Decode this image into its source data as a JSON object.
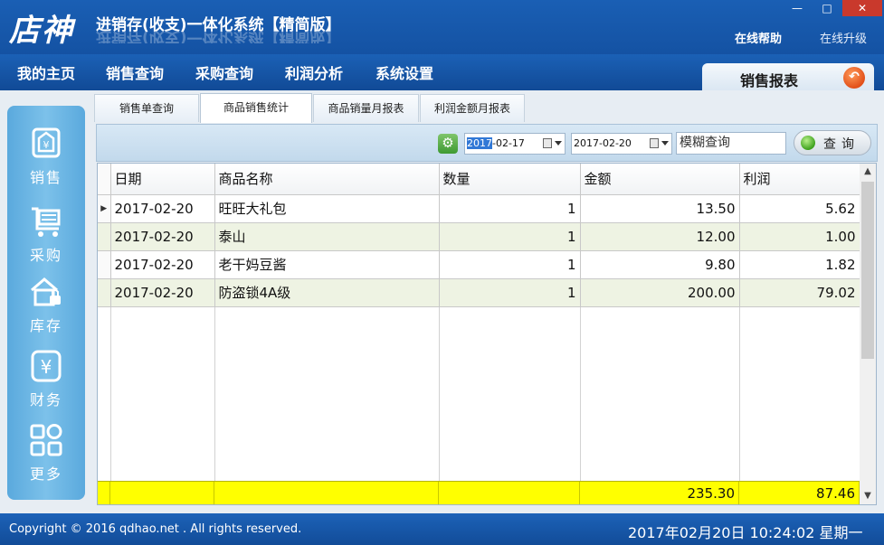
{
  "window": {
    "logo_text": "店神",
    "title": "进销存(收支)一体化系统【精简版】",
    "controls": {
      "minimize": "—",
      "maximize": "□",
      "close": "✕"
    },
    "links": {
      "help": "在线帮助",
      "upgrade": "在线升级"
    }
  },
  "menu": {
    "items": [
      {
        "label": "我的主页"
      },
      {
        "label": "销售查询"
      },
      {
        "label": "采购查询"
      },
      {
        "label": "利润分析"
      },
      {
        "label": "系统设置"
      }
    ],
    "report_tab": "销售报表"
  },
  "sidebar": {
    "items": [
      {
        "label": "销售",
        "icon": "sales-icon"
      },
      {
        "label": "采购",
        "icon": "cart-icon"
      },
      {
        "label": "库存",
        "icon": "warehouse-icon"
      },
      {
        "label": "财务",
        "icon": "yen-icon"
      },
      {
        "label": "更多",
        "icon": "grid-icon"
      }
    ]
  },
  "tabs": [
    {
      "label": "销售单查询",
      "active": false
    },
    {
      "label": "商品销售统计",
      "active": true
    },
    {
      "label": "商品销量月报表",
      "active": false
    },
    {
      "label": "利润金额月报表",
      "active": false
    }
  ],
  "toolbar": {
    "date_from_selected": "2017",
    "date_from_rest": "-02-17",
    "date_to": "2017-02-20",
    "search_text": "模糊查询",
    "query_label": "查询"
  },
  "table": {
    "columns": [
      "日期",
      "商品名称",
      "数量",
      "金额",
      "利润"
    ],
    "rows": [
      {
        "date": "2017-02-20",
        "name": "旺旺大礼包",
        "qty": "1",
        "amount": "13.50",
        "profit": "5.62"
      },
      {
        "date": "2017-02-20",
        "name": "泰山",
        "qty": "1",
        "amount": "12.00",
        "profit": "1.00"
      },
      {
        "date": "2017-02-20",
        "name": "老干妈豆酱",
        "qty": "1",
        "amount": "9.80",
        "profit": "1.82"
      },
      {
        "date": "2017-02-20",
        "name": "防盗锁4A级",
        "qty": "1",
        "amount": "200.00",
        "profit": "79.02"
      }
    ],
    "totals": {
      "amount": "235.30",
      "profit": "87.46"
    }
  },
  "status": {
    "copyright": "Copyright © 2016 qdhao.net . All rights reserved.",
    "datetime": "2017年02月20日  10:24:02  星期一"
  }
}
